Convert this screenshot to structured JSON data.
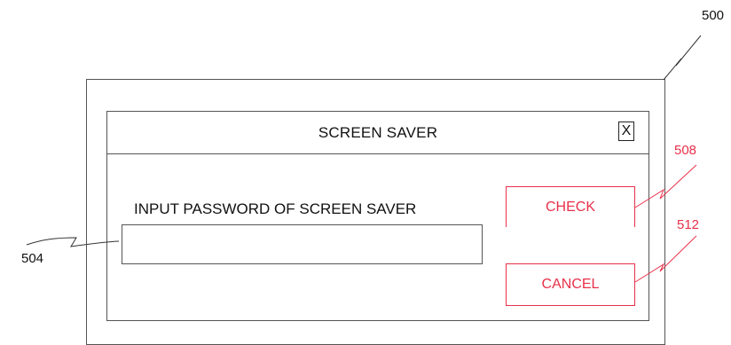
{
  "figure_refs": {
    "outer": "500",
    "input": "504",
    "check": "508",
    "cancel": "512"
  },
  "dialog": {
    "title": "SCREEN SAVER",
    "close_label": "X",
    "prompt": "INPUT PASSWORD OF SCREEN SAVER",
    "password_value": "",
    "check_label": "CHECK",
    "cancel_label": "CANCEL"
  },
  "colors": {
    "annotation_red": "#e8304a",
    "line": "#555555"
  },
  "icons": {
    "close": "close-icon"
  }
}
